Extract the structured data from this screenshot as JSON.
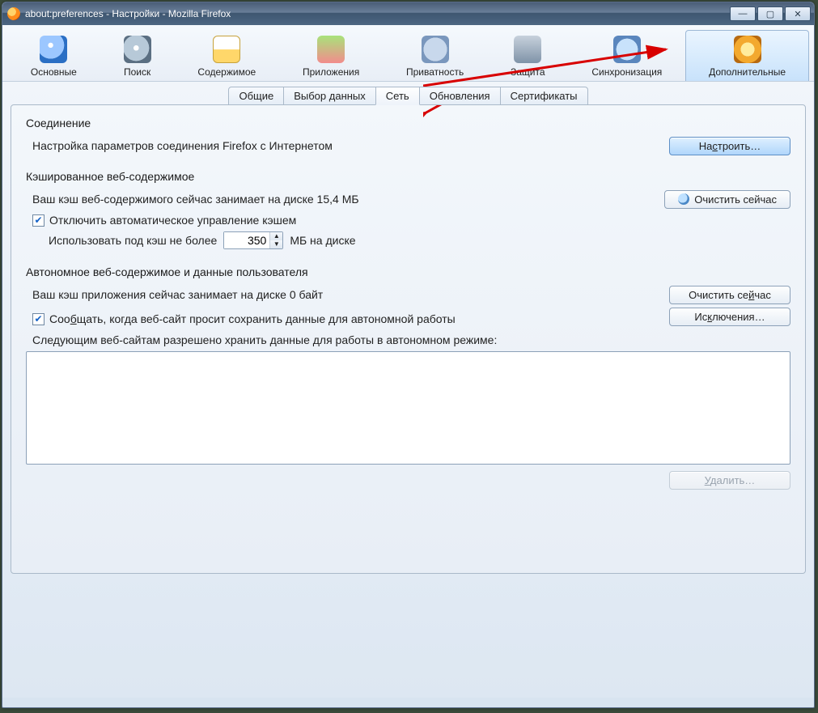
{
  "window": {
    "title": "about:preferences - Настройки - Mozilla Firefox"
  },
  "toolbar": {
    "items": [
      {
        "label": "Основные"
      },
      {
        "label": "Поиск"
      },
      {
        "label": "Содержимое"
      },
      {
        "label": "Приложения"
      },
      {
        "label": "Приватность"
      },
      {
        "label": "Защита"
      },
      {
        "label": "Синхронизация"
      },
      {
        "label": "Дополнительные"
      }
    ],
    "active_index": 7
  },
  "subtabs": {
    "items": [
      "Общие",
      "Выбор данных",
      "Сеть",
      "Обновления",
      "Сертификаты"
    ],
    "active_index": 2
  },
  "connection": {
    "title": "Соединение",
    "desc": "Настройка параметров соединения Firefox с Интернетом",
    "configure_btn": "Настроить…"
  },
  "cache": {
    "title": "Кэшированное веб-содержимое",
    "status": "Ваш кэш веб-содержимого сейчас занимает на диске 15,4 МБ",
    "clear_btn": "Очистить сейчас",
    "override_chk": "Отключить автоматическое управление кэшем",
    "limit_prefix": "Использовать под кэш не более",
    "limit_value": "350",
    "limit_suffix": "МБ на диске"
  },
  "offline": {
    "title": "Автономное веб-содержимое и данные пользователя",
    "status": "Ваш кэш приложения сейчас занимает на диске 0 байт",
    "clear_btn": "Очистить сейчас",
    "notify_chk": "Сообщать, когда веб-сайт просит сохранить данные для автономной работы",
    "exceptions_btn": "Исключения…",
    "list_label": "Следующим веб-сайтам разрешено хранить данные для работы в автономном режиме:",
    "delete_btn": "Удалить…"
  }
}
